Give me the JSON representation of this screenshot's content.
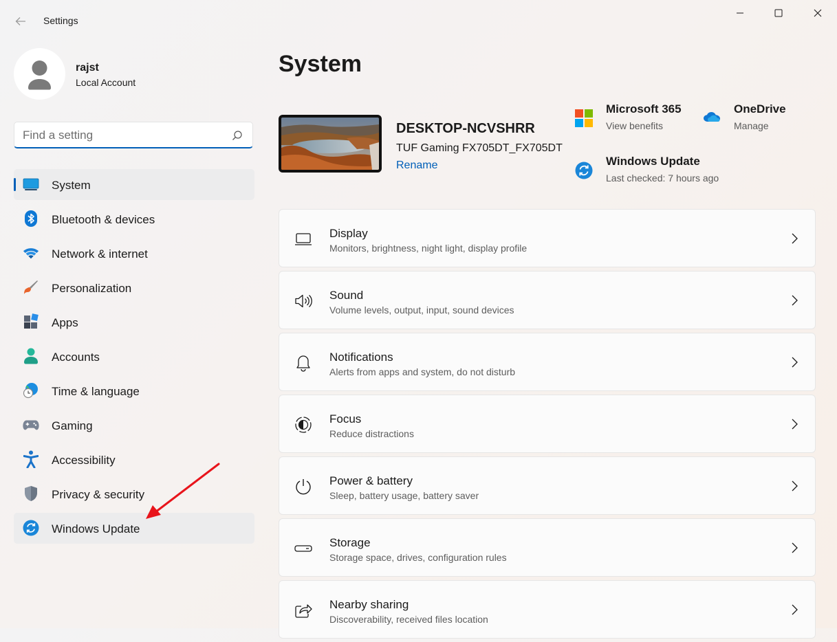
{
  "window": {
    "title": "Settings",
    "controls": [
      "minimize-icon",
      "maximize-icon",
      "close-icon"
    ]
  },
  "user": {
    "name": "rajst",
    "account_type": "Local Account"
  },
  "search": {
    "placeholder": "Find a setting",
    "value": ""
  },
  "sidebar": {
    "items": [
      {
        "label": "System",
        "icon": "system-icon",
        "active": true
      },
      {
        "label": "Bluetooth & devices",
        "icon": "bluetooth-icon"
      },
      {
        "label": "Network & internet",
        "icon": "wifi-icon"
      },
      {
        "label": "Personalization",
        "icon": "brush-icon"
      },
      {
        "label": "Apps",
        "icon": "apps-icon"
      },
      {
        "label": "Accounts",
        "icon": "accounts-icon"
      },
      {
        "label": "Time & language",
        "icon": "globe-clock-icon"
      },
      {
        "label": "Gaming",
        "icon": "gamepad-icon"
      },
      {
        "label": "Accessibility",
        "icon": "accessibility-icon"
      },
      {
        "label": "Privacy & security",
        "icon": "shield-icon"
      },
      {
        "label": "Windows Update",
        "icon": "windows-update-icon",
        "highlighted": true
      }
    ]
  },
  "main": {
    "title": "System",
    "device": {
      "name": "DESKTOP-NCVSHRR",
      "model": "TUF Gaming FX705DT_FX705DT",
      "rename_label": "Rename"
    },
    "quick_links": [
      {
        "title": "Microsoft 365",
        "subtitle": "View benefits",
        "icon": "microsoft-logo-icon"
      },
      {
        "title": "OneDrive",
        "subtitle": "Manage",
        "icon": "onedrive-cloud-icon"
      },
      {
        "title": "Windows Update",
        "subtitle": "Last checked: 7 hours ago",
        "icon": "windows-update-icon"
      }
    ],
    "cards": [
      {
        "title": "Display",
        "subtitle": "Monitors, brightness, night light, display profile",
        "icon": "display-icon"
      },
      {
        "title": "Sound",
        "subtitle": "Volume levels, output, input, sound devices",
        "icon": "speaker-icon"
      },
      {
        "title": "Notifications",
        "subtitle": "Alerts from apps and system, do not disturb",
        "icon": "bell-icon"
      },
      {
        "title": "Focus",
        "subtitle": "Reduce distractions",
        "icon": "focus-icon"
      },
      {
        "title": "Power & battery",
        "subtitle": "Sleep, battery usage, battery saver",
        "icon": "power-icon"
      },
      {
        "title": "Storage",
        "subtitle": "Storage space, drives, configuration rules",
        "icon": "storage-drive-icon"
      },
      {
        "title": "Nearby sharing",
        "subtitle": "Discoverability, received files location",
        "icon": "share-icon"
      }
    ]
  },
  "colors": {
    "accent": "#005fb8",
    "annotation_arrow": "#e8141b"
  }
}
